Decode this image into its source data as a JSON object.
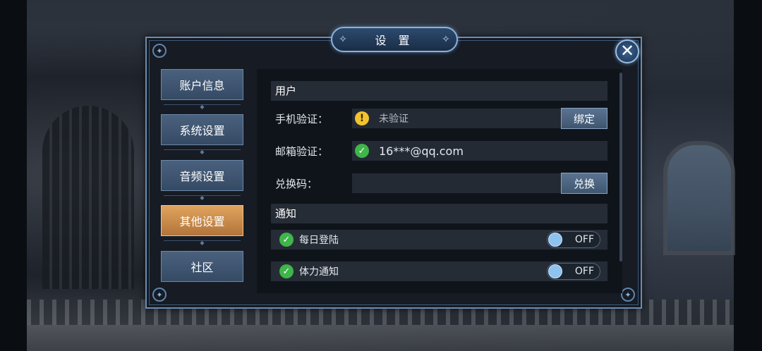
{
  "dialog": {
    "title": "设 置",
    "close_glyph": "✕"
  },
  "nav": {
    "items": [
      {
        "label": "账户信息",
        "active": false
      },
      {
        "label": "系统设置",
        "active": false
      },
      {
        "label": "音频设置",
        "active": false
      },
      {
        "label": "其他设置",
        "active": true
      },
      {
        "label": "社区",
        "active": false
      }
    ]
  },
  "user_section": {
    "title": "用户",
    "phone": {
      "label": "手机验证：",
      "status_icon": "warning-icon",
      "value": "未验证",
      "button": "绑定"
    },
    "email": {
      "label": "邮箱验证：",
      "status_icon": "check-icon",
      "value": "16***@qq.com"
    },
    "redeem": {
      "label": "兑换码：",
      "value": "",
      "button": "兑换"
    }
  },
  "notify_section": {
    "title": "通知",
    "items": [
      {
        "label": "每日登陆",
        "state": "OFF"
      },
      {
        "label": "体力通知",
        "state": "OFF"
      }
    ]
  },
  "colors": {
    "nav_active": "#d4955a",
    "nav_default": "#415673",
    "check": "#3fb54a",
    "warning": "#f2c230",
    "frame": "#6b8cb0"
  }
}
